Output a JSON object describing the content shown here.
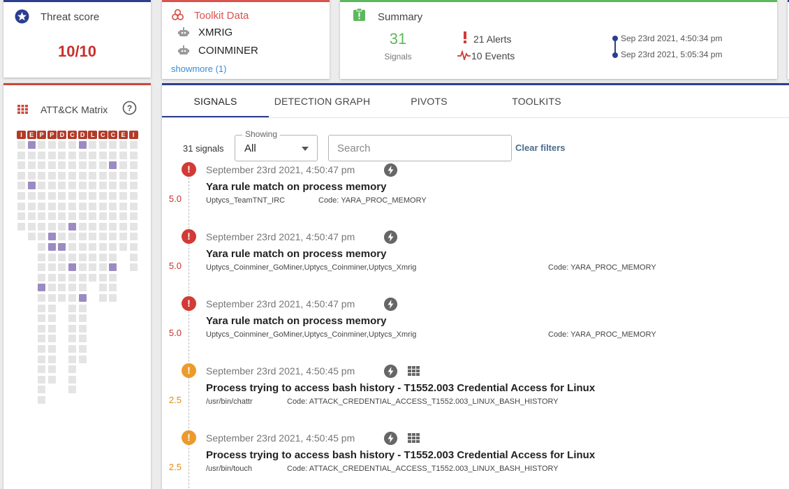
{
  "threat": {
    "title": "Threat score",
    "value": "10/10"
  },
  "toolkit": {
    "title": "Toolkit Data",
    "items": [
      "XMRIG",
      "COINMINER"
    ],
    "showmore": "showmore (1)"
  },
  "summary": {
    "title": "Summary",
    "signals_count": "31",
    "signals_label": "Signals",
    "alerts": "21 Alerts",
    "events": "10 Events",
    "timeline_start": "Sep 23rd 2021, 4:50:34 pm",
    "timeline_end": "Sep 23rd 2021, 5:05:34 pm"
  },
  "matrix": {
    "title": "ATT&CK Matrix",
    "tactics": [
      "I",
      "E",
      "P",
      "P",
      "D",
      "C",
      "D",
      "L",
      "C",
      "C",
      "E",
      "I"
    ]
  },
  "tabs": [
    "SIGNALS",
    "DETECTION GRAPH",
    "PIVOTS",
    "TOOLKITS"
  ],
  "filters": {
    "count": "31 signals",
    "showing_label": "Showing",
    "showing_value": "All",
    "search_placeholder": "Search",
    "clear": "Clear filters"
  },
  "signals": [
    {
      "time": "September 23rd 2021, 4:50:47 pm",
      "title": "Yara rule match on process memory",
      "score": "5.0",
      "source": "Uptycs_TeamTNT_IRC",
      "code": "Code: YARA_PROC_MEMORY"
    },
    {
      "time": "September 23rd 2021, 4:50:47 pm",
      "title": "Yara rule match on process memory",
      "score": "5.0",
      "source": "Uptycs_Coinminer_GoMiner,Uptycs_Coinminer,Uptycs_Xmrig",
      "code": "Code: YARA_PROC_MEMORY"
    },
    {
      "time": "September 23rd 2021, 4:50:47 pm",
      "title": "Yara rule match on process memory",
      "score": "5.0",
      "source": "Uptycs_Coinminer_GoMiner,Uptycs_Coinminer,Uptycs_Xmrig",
      "code": "Code: YARA_PROC_MEMORY"
    },
    {
      "time": "September 23rd 2021, 4:50:45 pm",
      "title": "Process trying to access bash history - T1552.003 Credential Access for Linux",
      "score": "2.5",
      "source": "/usr/bin/chattr",
      "code": "Code: ATTACK_CREDENTIAL_ACCESS_T1552.003_LINUX_BASH_HISTORY"
    },
    {
      "time": "September 23rd 2021, 4:50:45 pm",
      "title": "Process trying to access bash history - T1552.003 Credential Access for Linux",
      "score": "2.5",
      "source": "/usr/bin/touch",
      "code": "Code: ATTACK_CREDENTIAL_ACCESS_T1552.003_LINUX_BASH_HISTORY"
    }
  ],
  "colors": {
    "primary": "#2c3e8f",
    "danger": "#d23a36",
    "warning": "#ec9a2c",
    "success": "#5cb85c",
    "matrix_on": "#9c8bc2"
  }
}
